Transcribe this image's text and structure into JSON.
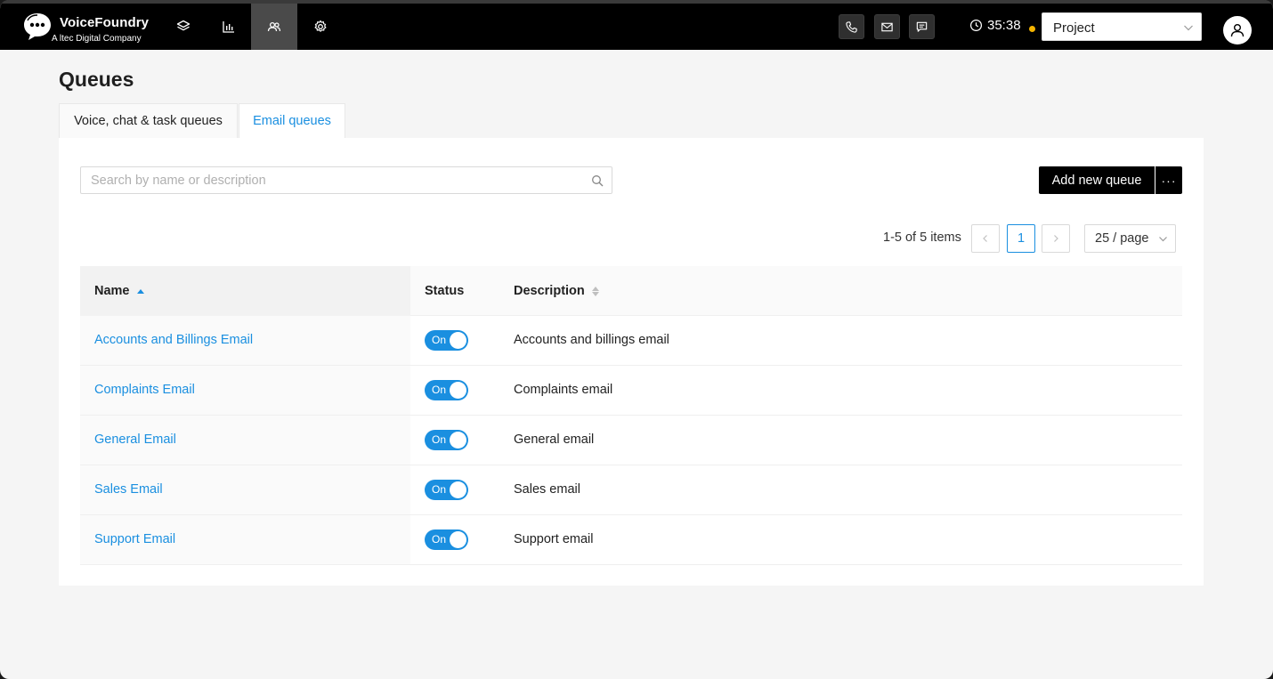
{
  "app": {
    "name": "VoiceFoundry",
    "tagline": "A ltec Digital Company"
  },
  "header": {
    "timer": "35:38",
    "project_select": {
      "value": "Project"
    },
    "status_color": "#f5b400"
  },
  "page": {
    "title": "Queues"
  },
  "tabs": [
    {
      "label": "Voice, chat & task queues",
      "active": false
    },
    {
      "label": "Email queues",
      "active": true
    }
  ],
  "toolbar": {
    "search_placeholder": "Search by name or description",
    "search_value": "",
    "add_label": "Add new queue",
    "more_label": "···"
  },
  "pagination": {
    "total_text": "1-5 of 5 items",
    "current_page": "1",
    "prev": "<",
    "next": ">",
    "page_size": "25 / page"
  },
  "table": {
    "columns": {
      "name": "Name",
      "status": "Status",
      "description": "Description"
    },
    "sort": {
      "column": "name",
      "direction": "ascending"
    },
    "rows": [
      {
        "name": "Accounts and Billings Email",
        "status": "On",
        "description": "Accounts and billings email"
      },
      {
        "name": "Complaints Email",
        "status": "On",
        "description": "Complaints email"
      },
      {
        "name": "General Email",
        "status": "On",
        "description": "General email"
      },
      {
        "name": "Sales Email",
        "status": "On",
        "description": "Sales email"
      },
      {
        "name": "Support Email",
        "status": "On",
        "description": "Support email"
      }
    ]
  },
  "colors": {
    "accent": "#1a8fe0",
    "topbar": "#000000",
    "nav_active": "#4a4a4a"
  },
  "icons": {
    "nav": [
      "layers-icon",
      "bar-chart-icon",
      "users-icon",
      "gear-icon"
    ],
    "tools": [
      "phone-icon",
      "mail-icon",
      "chat-icon"
    ]
  }
}
